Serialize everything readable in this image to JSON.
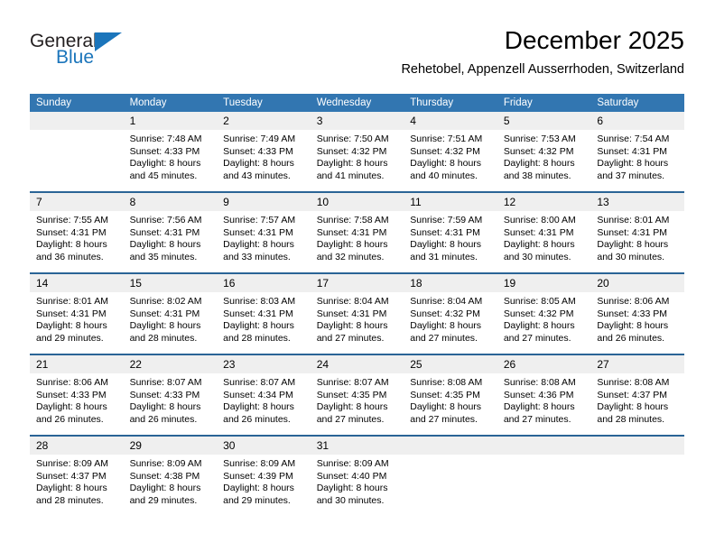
{
  "brand": {
    "name_top": "General",
    "name_bottom": "Blue",
    "accent_color": "#1b75bb",
    "flag_icon": "triangle-flag-icon"
  },
  "header": {
    "title": "December 2025",
    "subtitle": "Rehetobel, Appenzell Ausserrhoden, Switzerland"
  },
  "theme": {
    "header_blue": "#3276b1",
    "week_divider_blue": "#2a6496",
    "daynum_background": "#efefef"
  },
  "weekday_headers": [
    "Sunday",
    "Monday",
    "Tuesday",
    "Wednesday",
    "Thursday",
    "Friday",
    "Saturday"
  ],
  "labels": {
    "sunrise_prefix": "Sunrise:",
    "sunset_prefix": "Sunset:",
    "daylight_prefix": "Daylight:"
  },
  "weeks": [
    [
      {
        "day": "",
        "empty": true
      },
      {
        "day": "1",
        "sunrise": "Sunrise: 7:48 AM",
        "sunset": "Sunset: 4:33 PM",
        "daylight": "Daylight: 8 hours and 45 minutes."
      },
      {
        "day": "2",
        "sunrise": "Sunrise: 7:49 AM",
        "sunset": "Sunset: 4:33 PM",
        "daylight": "Daylight: 8 hours and 43 minutes."
      },
      {
        "day": "3",
        "sunrise": "Sunrise: 7:50 AM",
        "sunset": "Sunset: 4:32 PM",
        "daylight": "Daylight: 8 hours and 41 minutes."
      },
      {
        "day": "4",
        "sunrise": "Sunrise: 7:51 AM",
        "sunset": "Sunset: 4:32 PM",
        "daylight": "Daylight: 8 hours and 40 minutes."
      },
      {
        "day": "5",
        "sunrise": "Sunrise: 7:53 AM",
        "sunset": "Sunset: 4:32 PM",
        "daylight": "Daylight: 8 hours and 38 minutes."
      },
      {
        "day": "6",
        "sunrise": "Sunrise: 7:54 AM",
        "sunset": "Sunset: 4:31 PM",
        "daylight": "Daylight: 8 hours and 37 minutes."
      }
    ],
    [
      {
        "day": "7",
        "sunrise": "Sunrise: 7:55 AM",
        "sunset": "Sunset: 4:31 PM",
        "daylight": "Daylight: 8 hours and 36 minutes."
      },
      {
        "day": "8",
        "sunrise": "Sunrise: 7:56 AM",
        "sunset": "Sunset: 4:31 PM",
        "daylight": "Daylight: 8 hours and 35 minutes."
      },
      {
        "day": "9",
        "sunrise": "Sunrise: 7:57 AM",
        "sunset": "Sunset: 4:31 PM",
        "daylight": "Daylight: 8 hours and 33 minutes."
      },
      {
        "day": "10",
        "sunrise": "Sunrise: 7:58 AM",
        "sunset": "Sunset: 4:31 PM",
        "daylight": "Daylight: 8 hours and 32 minutes."
      },
      {
        "day": "11",
        "sunrise": "Sunrise: 7:59 AM",
        "sunset": "Sunset: 4:31 PM",
        "daylight": "Daylight: 8 hours and 31 minutes."
      },
      {
        "day": "12",
        "sunrise": "Sunrise: 8:00 AM",
        "sunset": "Sunset: 4:31 PM",
        "daylight": "Daylight: 8 hours and 30 minutes."
      },
      {
        "day": "13",
        "sunrise": "Sunrise: 8:01 AM",
        "sunset": "Sunset: 4:31 PM",
        "daylight": "Daylight: 8 hours and 30 minutes."
      }
    ],
    [
      {
        "day": "14",
        "sunrise": "Sunrise: 8:01 AM",
        "sunset": "Sunset: 4:31 PM",
        "daylight": "Daylight: 8 hours and 29 minutes."
      },
      {
        "day": "15",
        "sunrise": "Sunrise: 8:02 AM",
        "sunset": "Sunset: 4:31 PM",
        "daylight": "Daylight: 8 hours and 28 minutes."
      },
      {
        "day": "16",
        "sunrise": "Sunrise: 8:03 AM",
        "sunset": "Sunset: 4:31 PM",
        "daylight": "Daylight: 8 hours and 28 minutes."
      },
      {
        "day": "17",
        "sunrise": "Sunrise: 8:04 AM",
        "sunset": "Sunset: 4:31 PM",
        "daylight": "Daylight: 8 hours and 27 minutes."
      },
      {
        "day": "18",
        "sunrise": "Sunrise: 8:04 AM",
        "sunset": "Sunset: 4:32 PM",
        "daylight": "Daylight: 8 hours and 27 minutes."
      },
      {
        "day": "19",
        "sunrise": "Sunrise: 8:05 AM",
        "sunset": "Sunset: 4:32 PM",
        "daylight": "Daylight: 8 hours and 27 minutes."
      },
      {
        "day": "20",
        "sunrise": "Sunrise: 8:06 AM",
        "sunset": "Sunset: 4:33 PM",
        "daylight": "Daylight: 8 hours and 26 minutes."
      }
    ],
    [
      {
        "day": "21",
        "sunrise": "Sunrise: 8:06 AM",
        "sunset": "Sunset: 4:33 PM",
        "daylight": "Daylight: 8 hours and 26 minutes."
      },
      {
        "day": "22",
        "sunrise": "Sunrise: 8:07 AM",
        "sunset": "Sunset: 4:33 PM",
        "daylight": "Daylight: 8 hours and 26 minutes."
      },
      {
        "day": "23",
        "sunrise": "Sunrise: 8:07 AM",
        "sunset": "Sunset: 4:34 PM",
        "daylight": "Daylight: 8 hours and 26 minutes."
      },
      {
        "day": "24",
        "sunrise": "Sunrise: 8:07 AM",
        "sunset": "Sunset: 4:35 PM",
        "daylight": "Daylight: 8 hours and 27 minutes."
      },
      {
        "day": "25",
        "sunrise": "Sunrise: 8:08 AM",
        "sunset": "Sunset: 4:35 PM",
        "daylight": "Daylight: 8 hours and 27 minutes."
      },
      {
        "day": "26",
        "sunrise": "Sunrise: 8:08 AM",
        "sunset": "Sunset: 4:36 PM",
        "daylight": "Daylight: 8 hours and 27 minutes."
      },
      {
        "day": "27",
        "sunrise": "Sunrise: 8:08 AM",
        "sunset": "Sunset: 4:37 PM",
        "daylight": "Daylight: 8 hours and 28 minutes."
      }
    ],
    [
      {
        "day": "28",
        "sunrise": "Sunrise: 8:09 AM",
        "sunset": "Sunset: 4:37 PM",
        "daylight": "Daylight: 8 hours and 28 minutes."
      },
      {
        "day": "29",
        "sunrise": "Sunrise: 8:09 AM",
        "sunset": "Sunset: 4:38 PM",
        "daylight": "Daylight: 8 hours and 29 minutes."
      },
      {
        "day": "30",
        "sunrise": "Sunrise: 8:09 AM",
        "sunset": "Sunset: 4:39 PM",
        "daylight": "Daylight: 8 hours and 29 minutes."
      },
      {
        "day": "31",
        "sunrise": "Sunrise: 8:09 AM",
        "sunset": "Sunset: 4:40 PM",
        "daylight": "Daylight: 8 hours and 30 minutes."
      },
      {
        "day": "",
        "empty": true
      },
      {
        "day": "",
        "empty": true
      },
      {
        "day": "",
        "empty": true
      }
    ]
  ]
}
